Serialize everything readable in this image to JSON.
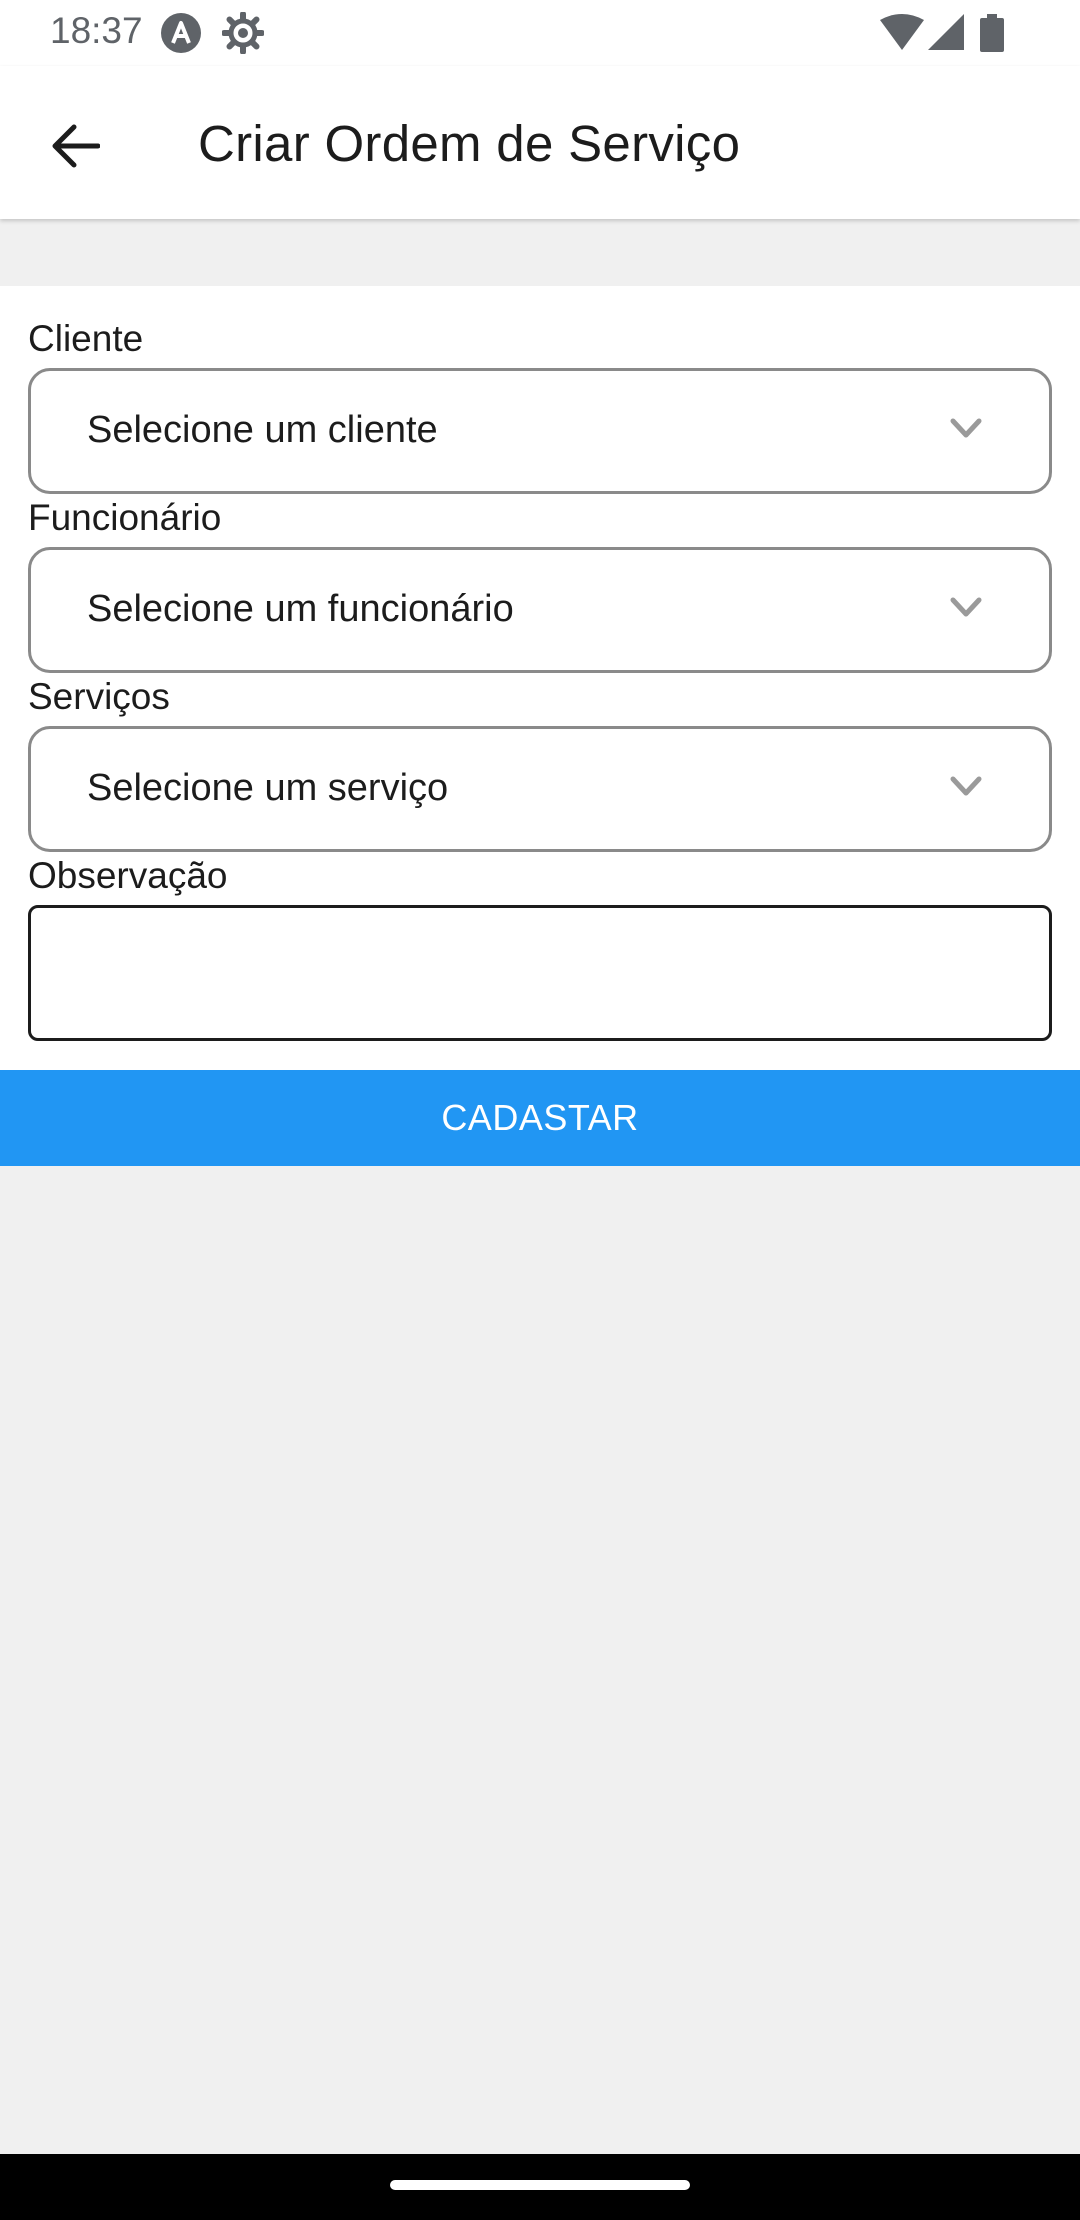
{
  "status_bar": {
    "time": "18:37",
    "left_icons": [
      "android-notification-icon",
      "settings-gear-icon"
    ],
    "right_icons": [
      "wifi-icon",
      "cell-signal-icon",
      "battery-icon"
    ]
  },
  "app_bar": {
    "back_icon": "arrow-left-icon",
    "title": "Criar Ordem de Serviço"
  },
  "form": {
    "cliente": {
      "label": "Cliente",
      "value": "Selecione um cliente",
      "icon": "chevron-down-icon"
    },
    "funcionario": {
      "label": "Funcionário",
      "value": "Selecione um funcionário",
      "icon": "chevron-down-icon"
    },
    "servicos": {
      "label": "Serviços",
      "value": "Selecione um serviço",
      "icon": "chevron-down-icon"
    },
    "observacao": {
      "label": "Observação",
      "value": ""
    },
    "submit_label": "CADASTAR"
  },
  "colors": {
    "accent": "#2196f3",
    "background": "#f0f0f0",
    "surface": "#ffffff",
    "text": "#1c1c1c"
  }
}
